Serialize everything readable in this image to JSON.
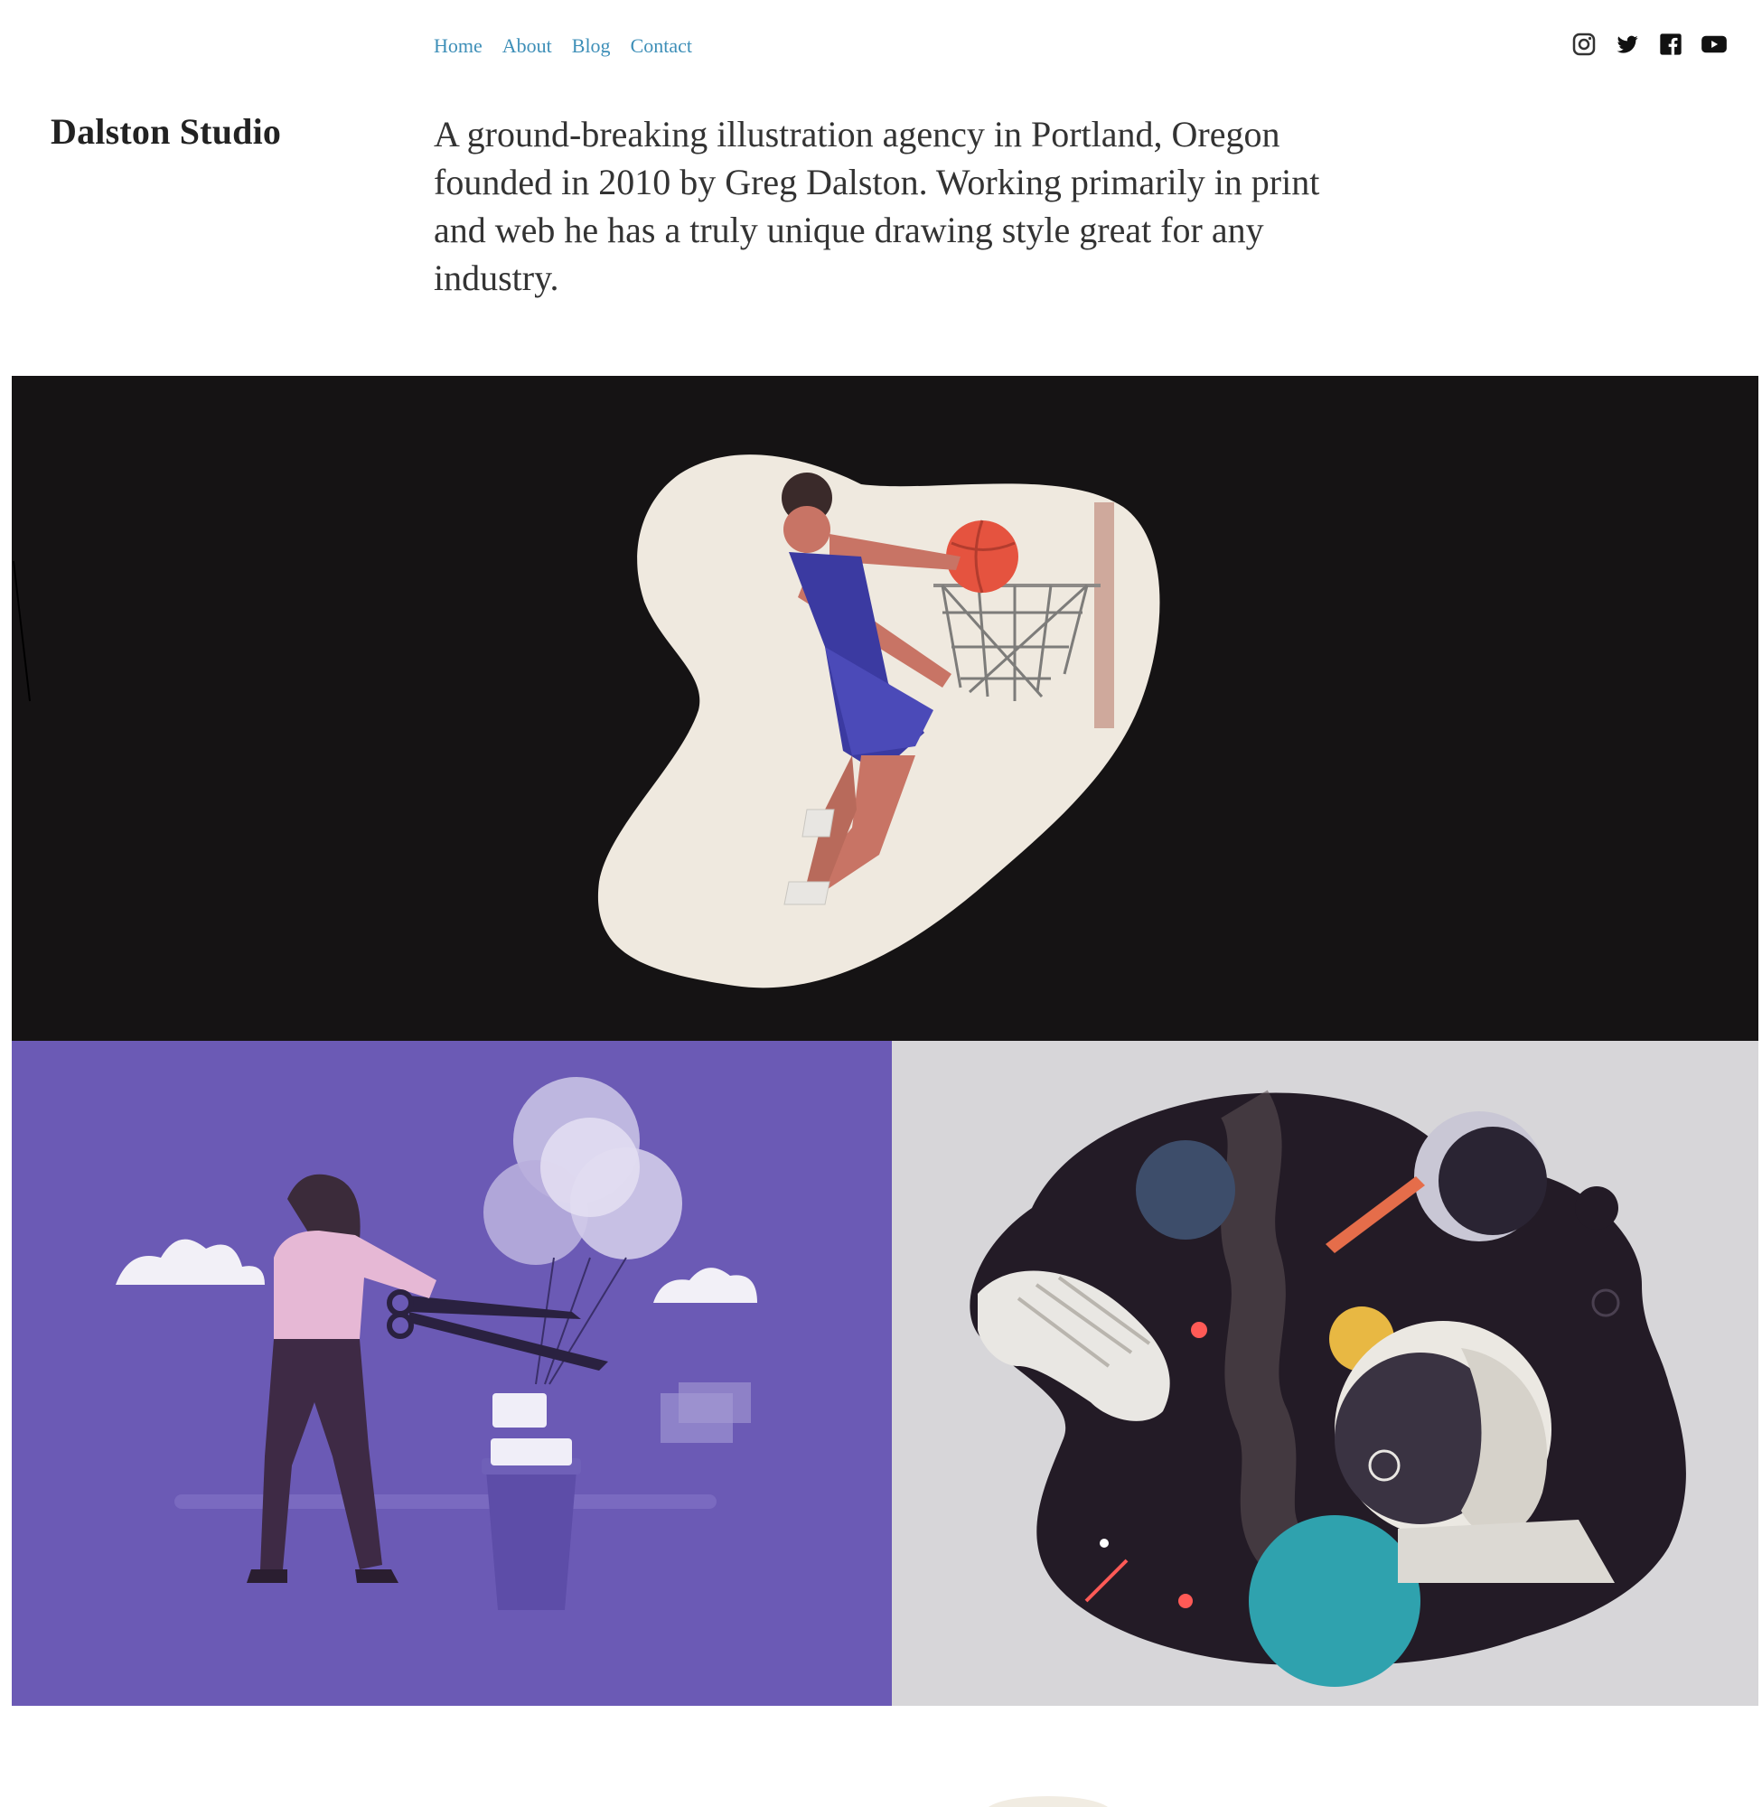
{
  "nav": {
    "items": [
      {
        "label": "Home"
      },
      {
        "label": "About"
      },
      {
        "label": "Blog"
      },
      {
        "label": "Contact"
      }
    ]
  },
  "social": {
    "icons": [
      "instagram-icon",
      "twitter-icon",
      "facebook-icon",
      "youtube-icon"
    ]
  },
  "brand": {
    "name": "Dalston Studio"
  },
  "intro": {
    "text": "A ground-breaking illustration agency in Portland, Oregon founded in 2010 by Greg Dalston. Working primarily in print and web he has a truly unique drawing style great for any industry."
  },
  "gallery": {
    "items": [
      {
        "subject": "basketball-player-illustration",
        "background": "#151314"
      },
      {
        "subject": "woman-cutting-balloons-illustration",
        "background": "#6b5ab5"
      },
      {
        "subject": "space-astronaut-illustration",
        "background": "#d7d6d9"
      }
    ]
  },
  "colors": {
    "link": "#3e8fb8",
    "text": "#222222"
  }
}
